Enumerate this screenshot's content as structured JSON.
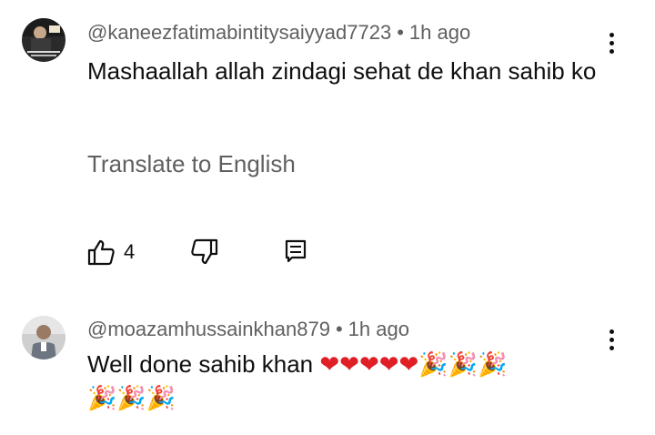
{
  "comments": [
    {
      "username": "@kaneezfatimabintitysaiyyad7723",
      "time": "1h ago",
      "text": "Mashaallah allah zindagi sehat de khan sahib ko",
      "translate_label": "Translate to English",
      "likes": "4",
      "avatar_icon": "profile-photo"
    },
    {
      "username": "@moazamhussainkhan879",
      "time": "1h ago",
      "text_main": "Well done sahib khan",
      "hearts": "❤❤❤❤❤",
      "party_line1": "🎉🎉🎉",
      "party_line2": "🎉🎉🎉",
      "avatar_icon": "profile-photo"
    }
  ],
  "colors": {
    "text": "#0f0f0f",
    "secondary": "#606060",
    "heart": "#e01e26"
  }
}
